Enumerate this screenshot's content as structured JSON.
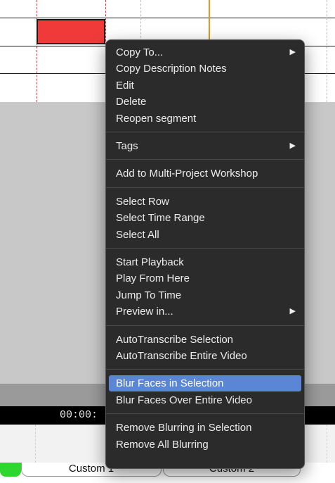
{
  "timeline": {
    "timecode": "00:00:"
  },
  "tabs": [
    {
      "label": "Custom 1"
    },
    {
      "label": "Custom 2"
    }
  ],
  "menu": {
    "groups": [
      [
        {
          "label": "Copy To...",
          "submenu": true
        },
        {
          "label": "Copy Description Notes"
        },
        {
          "label": "Edit"
        },
        {
          "label": "Delete"
        },
        {
          "label": "Reopen segment"
        }
      ],
      [
        {
          "label": "Tags",
          "submenu": true
        }
      ],
      [
        {
          "label": "Add to Multi-Project Workshop"
        }
      ],
      [
        {
          "label": "Select Row"
        },
        {
          "label": "Select Time Range"
        },
        {
          "label": "Select All"
        }
      ],
      [
        {
          "label": "Start Playback"
        },
        {
          "label": "Play From Here"
        },
        {
          "label": "Jump To Time"
        },
        {
          "label": "Preview in...",
          "submenu": true
        }
      ],
      [
        {
          "label": "AutoTranscribe Selection"
        },
        {
          "label": "AutoTranscribe Entire Video"
        }
      ],
      [
        {
          "label": "Blur Faces in Selection",
          "highlighted": true
        },
        {
          "label": "Blur Faces Over Entire Video"
        }
      ],
      [
        {
          "label": "Remove Blurring in Selection"
        },
        {
          "label": "Remove All Blurring"
        }
      ]
    ],
    "submenu_arrow": "▶",
    "highlight_color": "#5b86d6"
  },
  "colors": {
    "segment": "#f03a3a",
    "playhead": "#e49a12",
    "green_tab": "#2fd62f"
  }
}
